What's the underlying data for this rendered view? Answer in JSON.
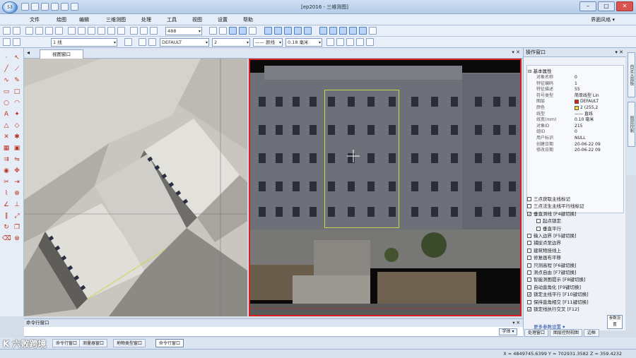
{
  "app": {
    "title": "[ep2016 - 三维测图]",
    "logo_text": "53"
  },
  "menu": [
    "文件",
    "绘图",
    "编辑",
    "三维测图",
    "处理",
    "工具",
    "视图",
    "设置",
    "帮助"
  ],
  "menu_right": "界面风格 ▾",
  "toolbar": {
    "zoom_value": "488",
    "layer_value": "1 线",
    "linetype_value": "DEFAULT",
    "lineweight_value": "2",
    "linestyle_value": "—— 颜线",
    "width_value": "0.18 毫米"
  },
  "doc_tab": "视图窗口",
  "right_panel": {
    "title": "操作窗口",
    "section": "基本属性",
    "props": [
      {
        "k": "对象名称",
        "v": "0"
      },
      {
        "k": "特征编码",
        "v": "1"
      },
      {
        "k": "特征描述",
        "v": "55"
      },
      {
        "k": "符号类型",
        "v": "简单线型 Lin"
      },
      {
        "k": "图层",
        "v": "DEFAULT",
        "color": "#e02020"
      },
      {
        "k": "颜色",
        "v": "2 (255,2",
        "color": "#f0e020"
      },
      {
        "k": "线型",
        "v": "—— 直线"
      },
      {
        "k": "线宽(mm)",
        "v": "0.10 毫米"
      },
      {
        "k": "对象ID",
        "v": "215"
      },
      {
        "k": "组ID",
        "v": "0"
      },
      {
        "k": "用户标识",
        "v": "NULL"
      },
      {
        "k": "创建日期",
        "v": "20-06-22 09"
      },
      {
        "k": "修改日期",
        "v": "20-06-22 09"
      }
    ],
    "options": [
      {
        "label": "三点获取主线标记",
        "checked": false,
        "indent": false
      },
      {
        "label": "三点法生主线平行线标记",
        "checked": false,
        "indent": false
      },
      {
        "label": "垂直测线 [F4键切换]",
        "checked": true,
        "indent": false
      },
      {
        "label": "起点锁定",
        "checked": false,
        "indent": true
      },
      {
        "label": "垂直平行",
        "checked": false,
        "indent": true
      },
      {
        "label": "输入边界 [F5键切换]",
        "checked": false,
        "indent": false
      },
      {
        "label": "捕捉点至边界",
        "checked": false,
        "indent": false
      },
      {
        "label": "建筑物挂线上",
        "checked": false,
        "indent": false
      },
      {
        "label": "修复画布平移",
        "checked": false,
        "indent": false
      },
      {
        "label": "只测高程 [F6键切换]",
        "checked": false,
        "indent": false
      },
      {
        "label": "测点自由 [F7键切换]",
        "checked": false,
        "indent": false
      },
      {
        "label": "智能测图提示 [F8键切换]",
        "checked": false,
        "indent": false
      },
      {
        "label": "自动直角化 [F9键切换]",
        "checked": false,
        "indent": false
      },
      {
        "label": "锁定主线平行 [F10键切换]",
        "checked": true,
        "indent": false
      },
      {
        "label": "保持直角相交 [F11键切换]",
        "checked": false,
        "indent": false
      },
      {
        "label": "锁定线执行交叉 [F12]",
        "checked": true,
        "indent": false
      }
    ],
    "settings_link": "更多参数设置 ▾",
    "apply_btn": "参数设置",
    "tabs": [
      "信息窗口",
      "流程",
      "边距"
    ]
  },
  "right_vtabs": [
    "自定义面板",
    "图层控制"
  ],
  "command": {
    "title": "命令行窗口",
    "combo": "字体 ▾"
  },
  "bottom_tabs": [
    "命令行窗口",
    "测量器窗口",
    "地物类型窗口",
    "命令行窗口"
  ],
  "watermark": "K 六败跨境",
  "status": {
    "coords": "X = 4849745.6399  Y = 702931.3582  Z = 359.4232"
  },
  "bottom_right_tabs": [
    "处理窗口",
    "图层控制视图",
    "边框"
  ]
}
